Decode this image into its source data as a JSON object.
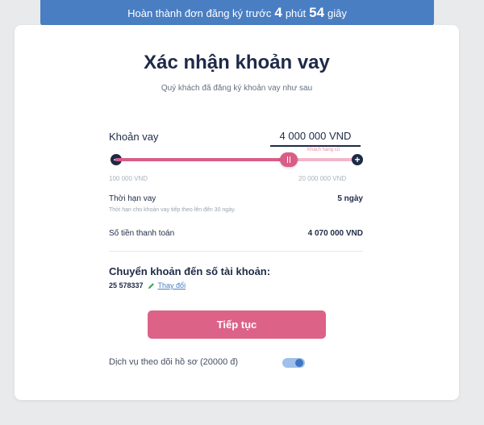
{
  "timer": {
    "prefix": "Hoàn thành đơn đăng ký trước",
    "minutes": "4",
    "minutes_unit": "phút",
    "seconds": "54",
    "seconds_unit": "giây"
  },
  "card": {
    "title": "Xác nhận khoản vay",
    "subtitle": "Quý khách đã đăng ký khoản vay như sau"
  },
  "loan": {
    "label": "Khoản vay",
    "amount": "4 000 000 VND",
    "hint": "Khách hàng cũ",
    "min_label": "100 000 VND",
    "max_label": "20 000 000 VND",
    "slider_fraction": 0.72,
    "minus_icon": "minus-circle-icon",
    "plus_icon": "plus-circle-icon",
    "minus_glyph": "−",
    "plus_glyph": "+"
  },
  "term": {
    "label": "Thời hạn vay",
    "value": "5 ngày",
    "note": "Thời hạn cho khoản vay tiếp theo lên đến 30 ngày."
  },
  "payment": {
    "label": "Số tiền thanh toán",
    "value": "4 070 000 VND"
  },
  "transfer": {
    "title": "Chuyển khoản đến số tài khoản:",
    "account_number": "25 578337",
    "change_label": "Thay đổi",
    "edit_icon": "pencil-icon"
  },
  "actions": {
    "continue_label": "Tiếp tục"
  },
  "service": {
    "label": "Dịch vụ theo dõi hồ sơ (20000 đ)",
    "enabled": true
  },
  "colors": {
    "banner": "#4a7ec2",
    "primary_pink": "#dc6288",
    "navy": "#1e2a47",
    "toggle_on": "#3f74c4"
  }
}
